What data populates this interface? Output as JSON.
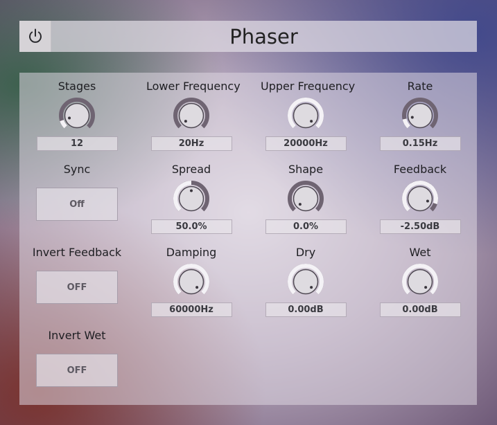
{
  "header": {
    "title": "Phaser",
    "power_icon": "power-icon"
  },
  "knobs": [
    {
      "id": "stages",
      "label": "Stages",
      "value": "12",
      "level": 0.1
    },
    {
      "id": "lower-frequency",
      "label": "Lower Frequency",
      "value": "20Hz",
      "level": 0.0
    },
    {
      "id": "upper-frequency",
      "label": "Upper Frequency",
      "value": "20000Hz",
      "level": 1.0
    },
    {
      "id": "rate",
      "label": "Rate",
      "value": "0.15Hz",
      "level": 0.12
    },
    {
      "id": "spread",
      "label": "Spread",
      "value": "50.0%",
      "level": 0.5
    },
    {
      "id": "shape",
      "label": "Shape",
      "value": "0.0%",
      "level": 0.0
    },
    {
      "id": "feedback",
      "label": "Feedback",
      "value": "-2.50dB",
      "level": 0.9
    },
    {
      "id": "damping",
      "label": "Damping",
      "value": "60000Hz",
      "level": 1.0
    },
    {
      "id": "dry",
      "label": "Dry",
      "value": "0.00dB",
      "level": 1.0
    },
    {
      "id": "wet",
      "label": "Wet",
      "value": "0.00dB",
      "level": 1.0
    }
  ],
  "toggles": [
    {
      "id": "sync",
      "label": "Sync",
      "value": "Off"
    },
    {
      "id": "invert-feedback",
      "label": "Invert Feedback",
      "value": "OFF"
    },
    {
      "id": "invert-wet",
      "label": "Invert Wet",
      "value": "OFF"
    }
  ]
}
